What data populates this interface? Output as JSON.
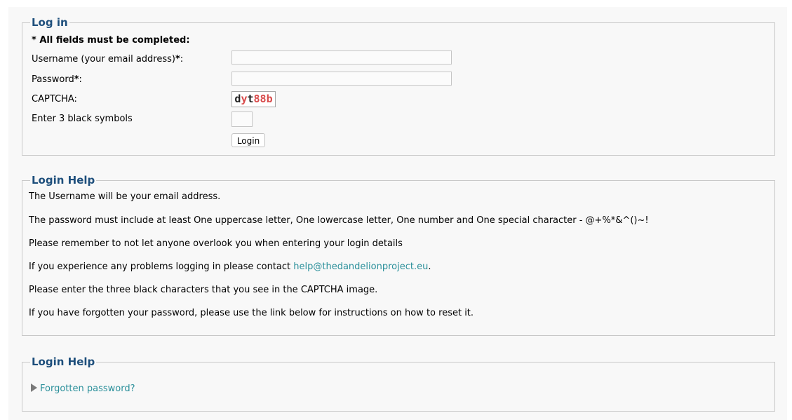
{
  "login_box": {
    "title": "Log in",
    "required_note": "* All fields must be completed:",
    "username_label": "Username (your email address)",
    "username_star": "*",
    "username_colon": ":",
    "password_label": "Password",
    "password_star": "*",
    "password_colon": ":",
    "captcha_label": "CAPTCHA:",
    "captcha_chars": [
      "d",
      "y",
      "t",
      "8",
      "8",
      "b"
    ],
    "captcha_colors": [
      "#222222",
      "#d84a4a",
      "#222222",
      "#d84a4a",
      "#d84a4a",
      "#d84a4a"
    ],
    "symbols_label": "Enter 3 black symbols",
    "login_button": "Login"
  },
  "help_box": {
    "title": "Login Help",
    "line1": "The Username will be your email address.",
    "line2": "The password must include at least One uppercase letter, One lowercase letter, One number and One special character - @+%*&^()~!",
    "line3": "Please remember to not let anyone overlook you when entering your login details",
    "line4_prefix": "If you experience any problems logging in please contact ",
    "line4_link": "help@thedandelionproject.eu",
    "line4_suffix": ".",
    "line5": "Please enter the three black characters that you see in the CAPTCHA image.",
    "line6": "If you have forgotten your password, please use the link below for instructions on how to reset it."
  },
  "help_box2": {
    "title": "Login Help",
    "forgot_link": "Forgotten password?"
  },
  "colors": {
    "legend": "#1e4f7c",
    "link": "#2a8f9a",
    "background": "#f8f8f8"
  }
}
